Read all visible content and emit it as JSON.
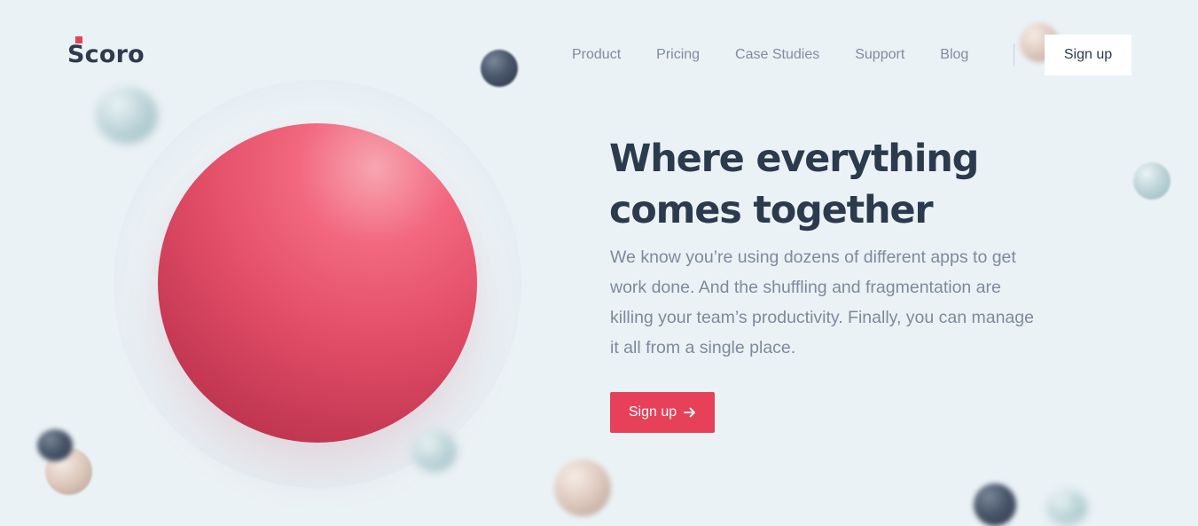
{
  "brand": {
    "name": "Scoro",
    "accent_color": "#e64159",
    "text_color": "#2c3a4d",
    "background_color": "#ebf2f6"
  },
  "nav": {
    "items": [
      {
        "label": "Product"
      },
      {
        "label": "Pricing"
      },
      {
        "label": "Case Studies"
      },
      {
        "label": "Support"
      },
      {
        "label": "Blog"
      }
    ],
    "signup_label": "Sign up"
  },
  "hero": {
    "headline_line1": "Where everything",
    "headline_line2": "comes together",
    "description": "We know you’re using dozens of different apps to get work done. And the shuffling and fragmentation are killing your team’s productivity. Finally, you can manage it all from a single place.",
    "cta_label": "Sign up",
    "cta_icon": "arrow-right-icon"
  }
}
